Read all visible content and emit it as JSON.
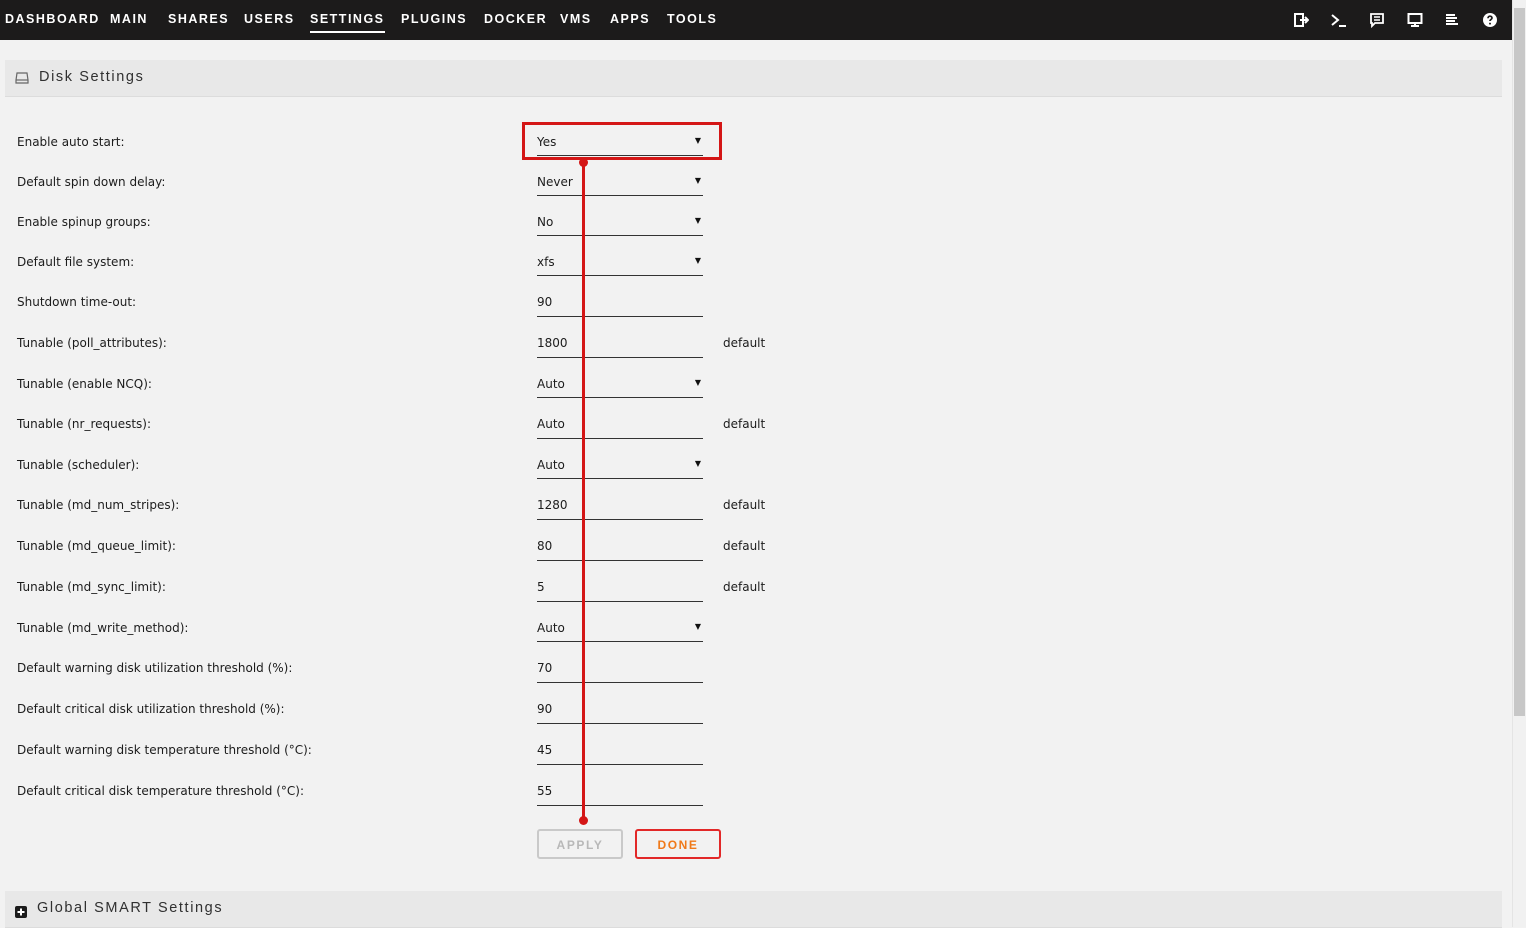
{
  "nav": {
    "items": [
      {
        "label": "DASHBOARD"
      },
      {
        "label": "MAIN"
      },
      {
        "label": "SHARES"
      },
      {
        "label": "USERS"
      },
      {
        "label": "SETTINGS",
        "active": true
      },
      {
        "label": "PLUGINS"
      },
      {
        "label": "DOCKER"
      },
      {
        "label": "VMS"
      },
      {
        "label": "APPS"
      },
      {
        "label": "TOOLS"
      }
    ],
    "icons": [
      "logout-icon",
      "terminal-icon",
      "feedback-icon",
      "monitor-icon",
      "log-icon",
      "help-icon"
    ]
  },
  "disk_settings": {
    "title": "Disk Settings",
    "rows": [
      {
        "label": "Enable auto start:",
        "value": "Yes",
        "type": "select"
      },
      {
        "label": "Default spin down delay:",
        "value": "Never",
        "type": "select"
      },
      {
        "label": "Enable spinup groups:",
        "value": "No",
        "type": "select"
      },
      {
        "label": "Default file system:",
        "value": "xfs",
        "type": "select"
      },
      {
        "label": "Shutdown time-out:",
        "value": "90",
        "type": "input"
      },
      {
        "label": "Tunable (poll_attributes):",
        "value": "1800",
        "type": "input",
        "note": "default"
      },
      {
        "label": "Tunable (enable NCQ):",
        "value": "Auto",
        "type": "select"
      },
      {
        "label": "Tunable (nr_requests):",
        "value": "Auto",
        "type": "input",
        "note": "default"
      },
      {
        "label": "Tunable (scheduler):",
        "value": "Auto",
        "type": "select"
      },
      {
        "label": "Tunable (md_num_stripes):",
        "value": "1280",
        "type": "input",
        "note": "default"
      },
      {
        "label": "Tunable (md_queue_limit):",
        "value": "80",
        "type": "input",
        "note": "default"
      },
      {
        "label": "Tunable (md_sync_limit):",
        "value": "5",
        "type": "input",
        "note": "default"
      },
      {
        "label": "Tunable (md_write_method):",
        "value": "Auto",
        "type": "select"
      },
      {
        "label": "Default warning disk utilization threshold (%):",
        "value": "70",
        "type": "input"
      },
      {
        "label": "Default critical disk utilization threshold (%):",
        "value": "90",
        "type": "input"
      },
      {
        "label": "Default warning disk temperature threshold (°C):",
        "value": "45",
        "type": "input"
      },
      {
        "label": "Default critical disk temperature threshold (°C):",
        "value": "55",
        "type": "input"
      }
    ],
    "apply_label": "APPLY",
    "done_label": "DONE"
  },
  "global_smart": {
    "title": "Global SMART Settings"
  },
  "colors": {
    "nav_background": "#1c1b1b",
    "page_background": "#f2f2f2",
    "annotation_red": "#d41616",
    "done_border": "#e22828",
    "done_text": "#f07a1a"
  }
}
